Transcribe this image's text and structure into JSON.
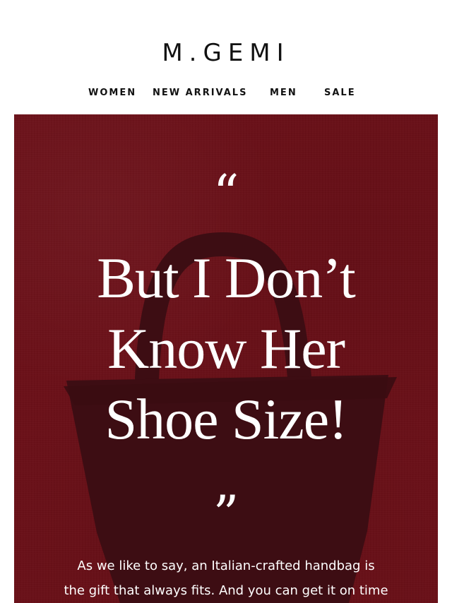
{
  "header": {
    "logo": "M.GEMI",
    "nav": [
      {
        "label": "WOMEN"
      },
      {
        "label": "NEW ARRIVALS"
      },
      {
        "label": "MEN"
      },
      {
        "label": "SALE"
      }
    ]
  },
  "hero": {
    "background_color": "#6a0f17",
    "silhouette_color": "#3d0d13",
    "open_quote": "“",
    "headline_lines": [
      "But I Don’t",
      "Know Her",
      "Shoe Size!"
    ],
    "close_quote": "”",
    "body_lines": [
      "As we like to say, an Italian-crafted handbag is",
      "the gift that always fits. And you can get it on time"
    ],
    "image_icon": "handbag-silhouette-icon"
  }
}
